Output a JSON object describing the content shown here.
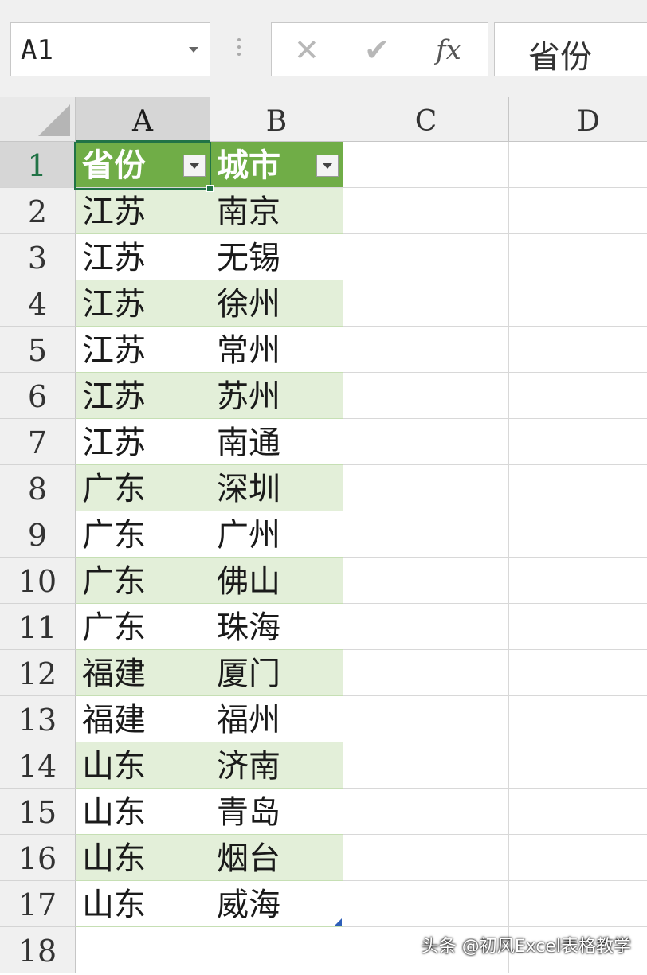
{
  "formula_bar": {
    "name_box": "A1",
    "cancel_icon": "✕",
    "enter_icon": "✔",
    "fx_label": "fx",
    "formula_value": "省份"
  },
  "columns": [
    "A",
    "B",
    "C",
    "D"
  ],
  "table": {
    "headers": [
      "省份",
      "城市"
    ],
    "rows": [
      [
        "江苏",
        "南京"
      ],
      [
        "江苏",
        "无锡"
      ],
      [
        "江苏",
        "徐州"
      ],
      [
        "江苏",
        "常州"
      ],
      [
        "江苏",
        "苏州"
      ],
      [
        "江苏",
        "南通"
      ],
      [
        "广东",
        "深圳"
      ],
      [
        "广东",
        "广州"
      ],
      [
        "广东",
        "佛山"
      ],
      [
        "广东",
        "珠海"
      ],
      [
        "福建",
        "厦门"
      ],
      [
        "福建",
        "福州"
      ],
      [
        "山东",
        "济南"
      ],
      [
        "山东",
        "青岛"
      ],
      [
        "山东",
        "烟台"
      ],
      [
        "山东",
        "威海"
      ]
    ]
  },
  "row_numbers": [
    "1",
    "2",
    "3",
    "4",
    "5",
    "6",
    "7",
    "8",
    "9",
    "10",
    "11",
    "12",
    "13",
    "14",
    "15",
    "16",
    "17",
    "18"
  ],
  "selected_cell": "A1",
  "colors": {
    "header_green": "#70ad47",
    "band_green": "#e3efd9",
    "selection": "#217346"
  },
  "watermark": "头条 @初风Excel表格教学"
}
